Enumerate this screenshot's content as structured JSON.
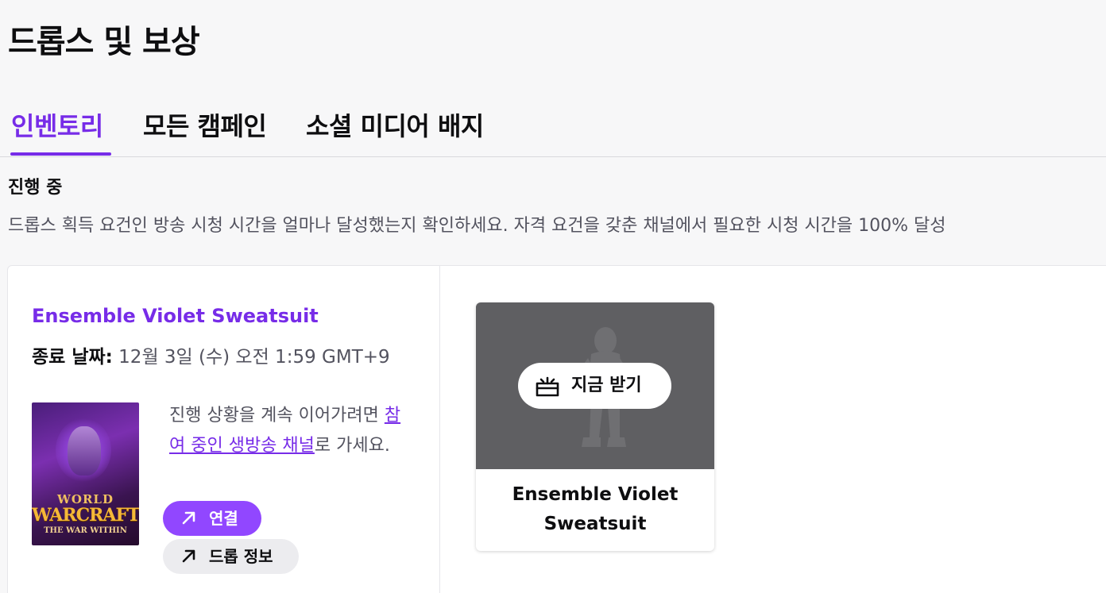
{
  "page": {
    "title": "드롭스 및 보상"
  },
  "tabs": [
    {
      "label": "인벤토리",
      "active": true
    },
    {
      "label": "모든 캠페인",
      "active": false
    },
    {
      "label": "소셜 미디어 배지",
      "active": false
    }
  ],
  "section": {
    "heading": "진행 중",
    "description": "드롭스 획득 요건인 방송 시청 시간을 얼마나 달성했는지 확인하세요. 자격 요건을 갖춘 채널에서 필요한 시청 시간을 100% 달성"
  },
  "campaign": {
    "title": "Ensemble Violet Sweatsuit",
    "end_date_label": "종료 날짜:",
    "end_date_value": "12월 3일 (수) 오전 1:59 GMT+9",
    "game_art": {
      "logo_line1": "WORLD",
      "logo_line2": "WARCRAFT",
      "logo_line3": "THE WAR WITHIN"
    },
    "progress_text_before": "진행 상황을 계속 이어가려면 ",
    "progress_link": "참여 중인 생방송 채널",
    "progress_text_after": "로 가세요.",
    "connect_button": "연결",
    "drop_info_button": "드롭 정보"
  },
  "reward": {
    "claim_button": "지금 받기",
    "name": "Ensemble Violet Sweatsuit"
  },
  "colors": {
    "accent": "#772ce8",
    "button_purple": "#9147ff",
    "text_secondary": "#53535f",
    "reward_image_bg": "#5f5f62"
  },
  "icons": {
    "connect": "external-arrow-icon",
    "drop_info": "external-arrow-icon",
    "claim": "gift-box-icon"
  }
}
